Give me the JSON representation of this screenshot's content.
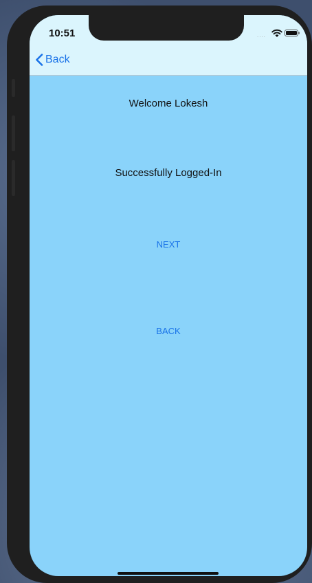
{
  "status_bar": {
    "time": "10:51",
    "signal_dots": "....",
    "wifi_icon": "wifi-icon",
    "battery_icon": "battery-icon"
  },
  "nav": {
    "back_label": "Back",
    "back_icon": "chevron-left-icon"
  },
  "main": {
    "welcome_text": "Welcome Lokesh",
    "status_text": "Successfully Logged-In",
    "next_label": "NEXT",
    "back_label": "BACK"
  },
  "colors": {
    "background": "#8ad3fa",
    "nav_background": "#dbf5fd",
    "link": "#1a73e8"
  }
}
